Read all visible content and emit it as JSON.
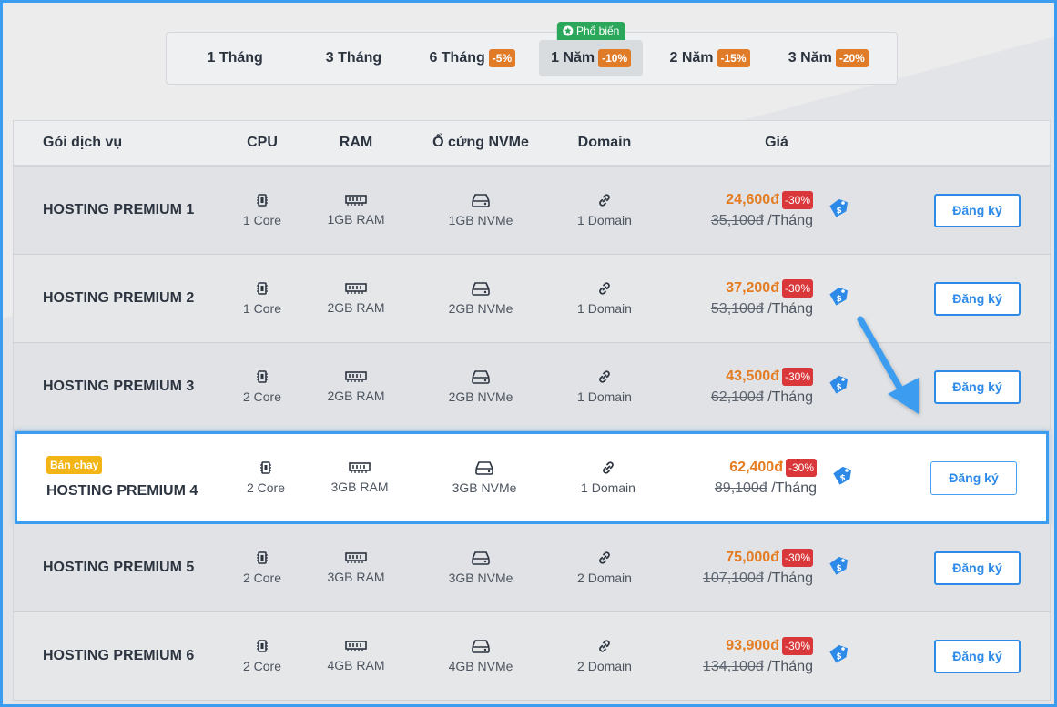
{
  "tabs": [
    {
      "label": "1 Tháng",
      "discount": ""
    },
    {
      "label": "3 Tháng",
      "discount": ""
    },
    {
      "label": "6 Tháng",
      "discount": "-5%"
    },
    {
      "label": "1 Năm",
      "discount": "-10%",
      "popular": "Phổ biến",
      "active": true
    },
    {
      "label": "2 Năm",
      "discount": "-15%"
    },
    {
      "label": "3 Năm",
      "discount": "-20%"
    }
  ],
  "headers": {
    "name": "Gói dịch vụ",
    "cpu": "CPU",
    "ram": "RAM",
    "disk": "Ổ cứng NVMe",
    "domain": "Domain",
    "price": "Giá"
  },
  "badge_hot": "Bán chạy",
  "button_label": "Đăng ký",
  "per_unit": "/Tháng",
  "plans": [
    {
      "name": "HOSTING PREMIUM 1",
      "cpu": "1 Core",
      "ram": "1GB RAM",
      "disk": "1GB NVMe",
      "domain": "1 Domain",
      "price": "24,600đ",
      "discount": "-30%",
      "old_price": "35,100đ"
    },
    {
      "name": "HOSTING PREMIUM 2",
      "cpu": "1 Core",
      "ram": "2GB RAM",
      "disk": "2GB NVMe",
      "domain": "1 Domain",
      "price": "37,200đ",
      "discount": "-30%",
      "old_price": "53,100đ"
    },
    {
      "name": "HOSTING PREMIUM 3",
      "cpu": "2 Core",
      "ram": "2GB RAM",
      "disk": "2GB NVMe",
      "domain": "1 Domain",
      "price": "43,500đ",
      "discount": "-30%",
      "old_price": "62,100đ"
    },
    {
      "name": "HOSTING PREMIUM 4",
      "cpu": "2 Core",
      "ram": "3GB RAM",
      "disk": "3GB NVMe",
      "domain": "1 Domain",
      "price": "62,400đ",
      "discount": "-30%",
      "old_price": "89,100đ",
      "hot": true
    },
    {
      "name": "HOSTING PREMIUM 5",
      "cpu": "2 Core",
      "ram": "3GB RAM",
      "disk": "3GB NVMe",
      "domain": "2 Domain",
      "price": "75,000đ",
      "discount": "-30%",
      "old_price": "107,100đ"
    },
    {
      "name": "HOSTING PREMIUM 6",
      "cpu": "2 Core",
      "ram": "4GB RAM",
      "disk": "4GB NVMe",
      "domain": "2 Domain",
      "price": "93,900đ",
      "discount": "-30%",
      "old_price": "134,100đ"
    }
  ],
  "colors": {
    "accent": "#2d8ae8",
    "price": "#e47c22",
    "discount_badge": "#e07b28",
    "off_badge": "#d9373a",
    "popular": "#2aa75a",
    "hot": "#f3b416"
  }
}
